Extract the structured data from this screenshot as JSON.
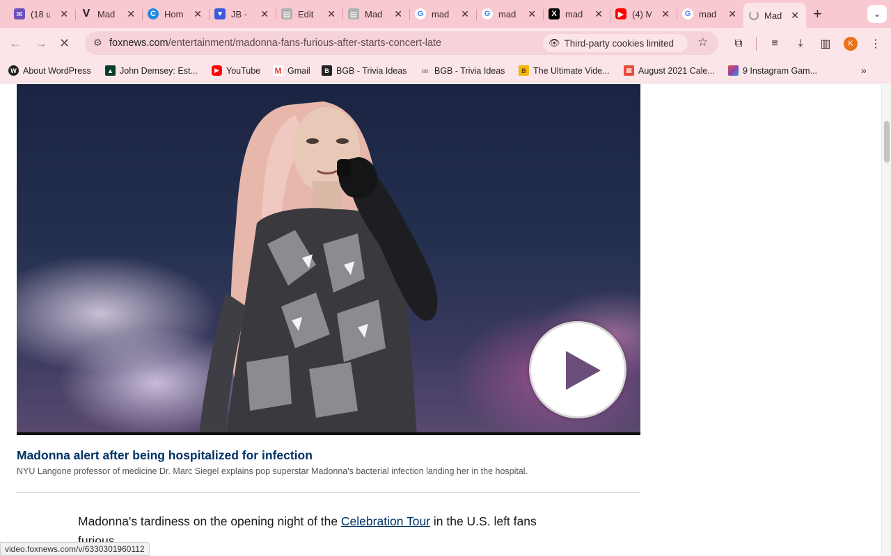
{
  "browser": {
    "tabs": [
      {
        "title": "(18 u",
        "icon": "mail-icon",
        "color": "#6b4fbb"
      },
      {
        "title": "Mad",
        "icon": "v-logo-icon",
        "color": "#222222"
      },
      {
        "title": "Hom",
        "icon": "c-logo-icon",
        "color": "#1e88e5"
      },
      {
        "title": "JB -",
        "icon": "heart-icon",
        "color": "#3b5bdb"
      },
      {
        "title": "Edit",
        "icon": "news-icon",
        "color": "#9a9a9a"
      },
      {
        "title": "Mad",
        "icon": "news-icon",
        "color": "#9a9a9a"
      },
      {
        "title": "mad",
        "icon": "google-icon",
        "color": "#4285f4"
      },
      {
        "title": "mad",
        "icon": "google-icon",
        "color": "#4285f4"
      },
      {
        "title": "mad",
        "icon": "x-logo-icon",
        "color": "#000000"
      },
      {
        "title": "(4) M",
        "icon": "youtube-icon",
        "color": "#ff0000"
      },
      {
        "title": "mad",
        "icon": "google-icon",
        "color": "#4285f4"
      },
      {
        "title": "Mad",
        "icon": "loading-icon",
        "color": "#8a8a8a"
      }
    ],
    "url_host": "foxnews.com",
    "url_path": "/entertainment/madonna-fans-furious-after-starts-concert-late",
    "cookie_chip": "Third-party cookies limited",
    "avatar_letter": "K",
    "bookmarks": [
      {
        "label": "About WordPress",
        "icon": "wordpress-icon",
        "color": "#222222"
      },
      {
        "label": "John Demsey: Est...",
        "icon": "bookmark-site-icon",
        "color": "#0b3d2e"
      },
      {
        "label": "YouTube",
        "icon": "youtube-icon",
        "color": "#ff0000"
      },
      {
        "label": "Gmail",
        "icon": "gmail-icon",
        "color": "#ea4335"
      },
      {
        "label": "BGB - Trivia Ideas",
        "icon": "bookmark-site-icon",
        "color": "#222222"
      },
      {
        "label": "BGB - Trivia Ideas",
        "icon": "bookmark-site-icon",
        "color": "#888888"
      },
      {
        "label": "The Ultimate Vide...",
        "icon": "bookmark-site-icon",
        "color": "#f2b705"
      },
      {
        "label": "August 2021 Cale...",
        "icon": "calendar-icon",
        "color": "#e74c3c"
      },
      {
        "label": "9 Instagram Gam...",
        "icon": "bookmark-site-icon",
        "color": "#8e44ad"
      }
    ]
  },
  "article": {
    "video_title": "Madonna alert after being hospitalized for infection",
    "video_description": "NYU Langone professor of medicine Dr. Marc Siegel explains pop superstar Madonna's bacterial infection landing her in the hospital.",
    "paragraph_before": "Madonna's tardiness on the opening night of the ",
    "paragraph_link": "Celebration Tour",
    "paragraph_after": " in the U.S. left fans furious."
  },
  "status_bar": "video.foxnews.com/v/6330301960112"
}
